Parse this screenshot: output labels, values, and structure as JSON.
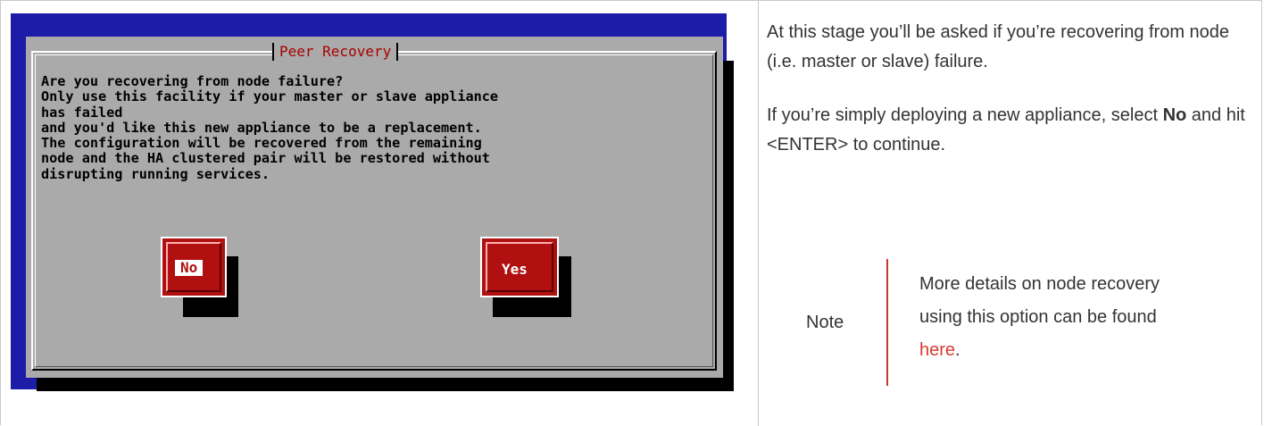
{
  "dialog": {
    "title": "Peer Recovery",
    "message": "Are you recovering from node failure?\nOnly use this facility if your master or slave appliance\nhas failed\nand you'd like this new appliance to be a replacement.\nThe configuration will be recovered from the remaining\nnode and the HA clustered pair will be restored without\ndisrupting running services.",
    "no_label": "No",
    "yes_label": "Yes"
  },
  "description": {
    "para1": "At this stage you’ll be asked if you’re recovering from node (i.e. master or slave) failure.",
    "para2_prefix": "If you’re simply deploying a new appliance, select ",
    "para2_bold": "No",
    "para2_suffix": " and hit <ENTER> to continue."
  },
  "note": {
    "label": "Note",
    "text_prefix": "More details on node recovery using this option can be found ",
    "link_text": "here",
    "text_suffix": "."
  },
  "colors": {
    "terminal_bg": "#1c1ca8",
    "dialog_bg": "#aaaaaa",
    "button_red": "#b01010",
    "accent_link": "#d63b2f"
  }
}
